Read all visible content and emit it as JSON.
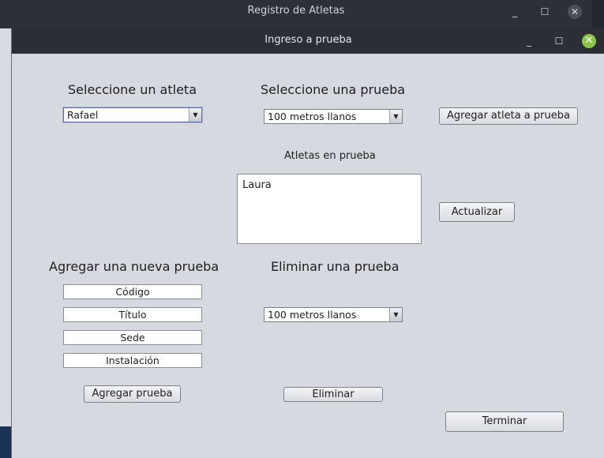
{
  "background_window": {
    "title": "Registro de Atletas",
    "minimize_glyph": "_",
    "maximize_glyph": "☐",
    "close_glyph": "✕"
  },
  "dialog": {
    "title": "Ingreso a prueba",
    "minimize_glyph": "_",
    "maximize_glyph": "☐",
    "close_glyph": "✕"
  },
  "select_athlete": {
    "heading": "Seleccione un atleta",
    "selected": "Rafael"
  },
  "select_event": {
    "heading": "Seleccione una prueba",
    "selected": "100 metros llanos"
  },
  "add_athlete_button": "Agregar atleta a prueba",
  "athletes_in_event": {
    "label": "Atletas en prueba",
    "items": [
      "Laura"
    ]
  },
  "update_button": "Actualizar",
  "new_event": {
    "heading": "Agregar una nueva prueba",
    "fields": {
      "code": "Código",
      "title": "Título",
      "venue": "Sede",
      "facility": "Instalación"
    },
    "add_button": "Agregar prueba"
  },
  "delete_event": {
    "heading": "Eliminar una prueba",
    "selected": "100 metros llanos",
    "delete_button": "Eliminar"
  },
  "finish_button": "Terminar",
  "icons": {
    "dropdown": "▼"
  },
  "colors": {
    "titlebar": "#2b2e35",
    "dialog_bg": "#d6d9e0",
    "close_accent": "#8fc44a"
  }
}
